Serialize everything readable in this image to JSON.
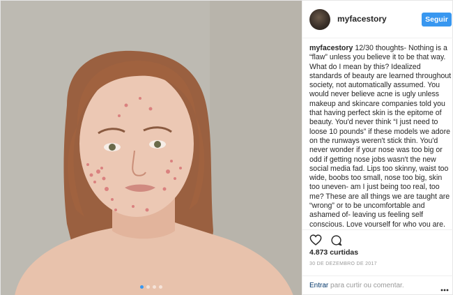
{
  "header": {
    "username": "myfacestory",
    "follow_label": "Seguir"
  },
  "caption": {
    "username": "myfacestory",
    "text": "12/30 thoughts- Nothing is a “flaw” unless you believe it to be that way. What do I mean by this? Idealized standards of beauty are learned throughout society, not automatically assumed. You would never believe acne is ugly unless makeup and skincare companies told you that having perfect skin is the epitome of beauty. You'd never think “I just need to loose 10 pounds” if these models we adore on the runways weren't stick thin. You'd never wonder if your nose was too big or odd if getting nose jobs wasn't the new social media fad. Lips too skinny, waist too wide, boobs too small, nose too big, skin too uneven- am I just being too real, too me? These are all things we are taught are “wrong” or to be uncomfortable and ashamed of- leaving us feeling self conscious. Love yourself for who you are, be comfortable owning that"
  },
  "actions": {
    "like_icon": "heart-icon",
    "comment_icon": "comment-bubble-icon"
  },
  "likes": "4.873 curtidas",
  "date": "30 DE DEZEMBRO DE 2017",
  "comment_bar": {
    "login_link": "Entrar",
    "prompt": " para curtir ou comentar.",
    "more_icon": "more-options-icon"
  },
  "carousel": {
    "slides": 4,
    "active_index": 0
  },
  "colors": {
    "accent": "#3897f0",
    "muted": "#999999",
    "link": "#003569"
  }
}
